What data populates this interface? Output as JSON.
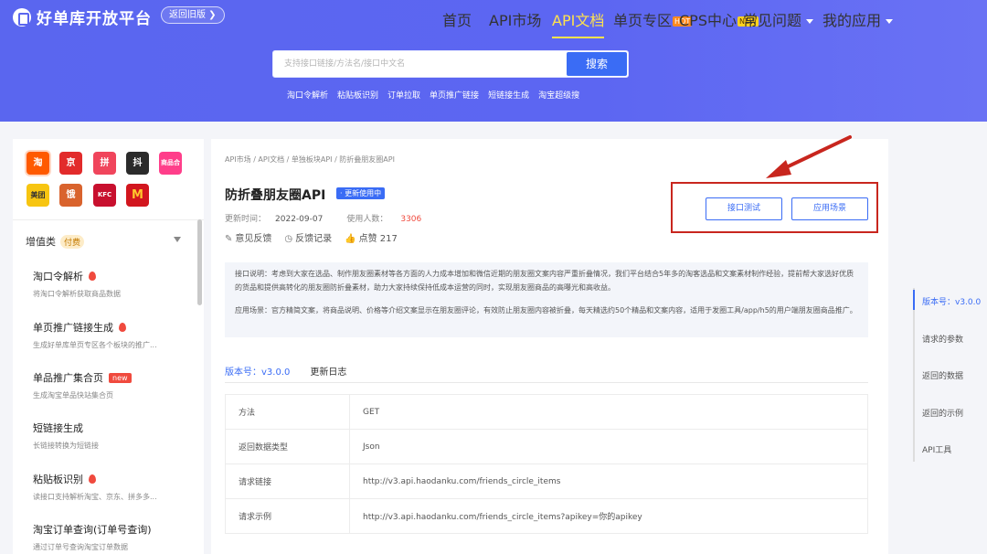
{
  "header": {
    "brand": "好单库开放平台",
    "old_version_btn": "返回旧版 ❯",
    "nav": [
      {
        "label": "首页"
      },
      {
        "label": "API市场"
      },
      {
        "label": "API文档"
      },
      {
        "label": "单页专区",
        "tag": "HOT"
      },
      {
        "label": "CPS中心",
        "tag": "NEW"
      },
      {
        "label": "常见问题"
      },
      {
        "label": "我的应用"
      }
    ],
    "search_placeholder": "支持接口链接/方法名/接口中文名",
    "search_btn": "搜索",
    "quick_links": [
      "淘口令解析",
      "粘贴板识别",
      "订单拉取",
      "单页推广链接",
      "短链接生成",
      "淘宝超级搜"
    ]
  },
  "sidebar": {
    "platforms": [
      {
        "label": "淘",
        "color": "#ff5a00"
      },
      {
        "label": "京",
        "color": "#e22b2b"
      },
      {
        "label": "拼",
        "color": "#f0455c"
      },
      {
        "label": "抖",
        "color": "#2b2b2b"
      },
      {
        "label": "商品合",
        "color": "#ff3e8a"
      },
      {
        "label": "美团",
        "color": "#f7c511"
      },
      {
        "label": "饿",
        "color": "#d9632d"
      },
      {
        "label": "KFC",
        "color": "#c8102e"
      },
      {
        "label": "M",
        "color": "#d2161e"
      }
    ],
    "category": "增值类",
    "category_badge": "付费",
    "items": [
      {
        "title": "淘口令解析",
        "desc": "将淘口令解析获取商品数据",
        "badge": "flame"
      },
      {
        "title": "单页推广链接生成",
        "desc": "生成好单库单页专区各个板块的推广...",
        "badge": "flame"
      },
      {
        "title": "单品推广集合页",
        "desc": "生成淘宝单品快站集合页",
        "badge": "new",
        "badge_text": "new"
      },
      {
        "title": "短链接生成",
        "desc": "长链接转换为短链接",
        "badge": ""
      },
      {
        "title": "粘贴板识别",
        "desc": "读接口支持解析淘宝、京东、拼多多...",
        "badge": "flame"
      },
      {
        "title": "淘宝订单查询(订单号查询)",
        "desc": "通过订单号查询淘宝订单数据",
        "badge": ""
      }
    ]
  },
  "main": {
    "breadcrumb": "API市场 / API文档 / 单独板块API / 防折叠朋友圈API",
    "title": "防折叠朋友圈API",
    "status": "· 更新使用中",
    "update_label": "更新时间：",
    "update_value": "2022-09-07",
    "users_label": "使用人数：",
    "users_value": "3306",
    "feedback": "意见反馈",
    "feedback_record": "反馈记录",
    "like": "点赞 217",
    "btn_test": "接口测试",
    "btn_scene": "应用场景",
    "desc1": "接口说明：考虑到大家在选品、制作朋友圈素材等各方面的人力成本增加和微信近期的朋友圈文案内容严重折叠情况，我们平台结合5年多的淘客选品和文案素材制作经验，提前帮大家选好优质的货品和提供高转化的朋友圈防折叠素材，助力大家持续保持低成本运营的同时，实现朋友圈商品的高曝光和高收益。",
    "desc2": "应用场景：官方精简文案，将商品说明、价格等介绍文案显示在朋友圈评论，有效防止朋友圈内容被折叠，每天精选约50个精品和文案内容，适用于发圈工具/app/h5的用户端朋友圈商品推广。",
    "version_tab": "版本号：v3.0.0",
    "changelog_tab": "更新日志",
    "table": [
      {
        "k": "方法",
        "v": "GET"
      },
      {
        "k": "返回数据类型",
        "v": "Json"
      },
      {
        "k": "请求链接",
        "v": "http://v3.api.haodanku.com/friends_circle_items"
      },
      {
        "k": "请求示例",
        "v": "http://v3.api.haodanku.com/friends_circle_items?apikey=你的apikey"
      }
    ]
  },
  "anchors": [
    "版本号：v3.0.0",
    "请求的参数",
    "返回的数据",
    "返回的示例",
    "API工具"
  ],
  "colors": {
    "primary": "#3a6cf5",
    "header_bg": "#5a66ef",
    "highlight": "#c8261e",
    "accent_yellow": "#ffe24d"
  }
}
